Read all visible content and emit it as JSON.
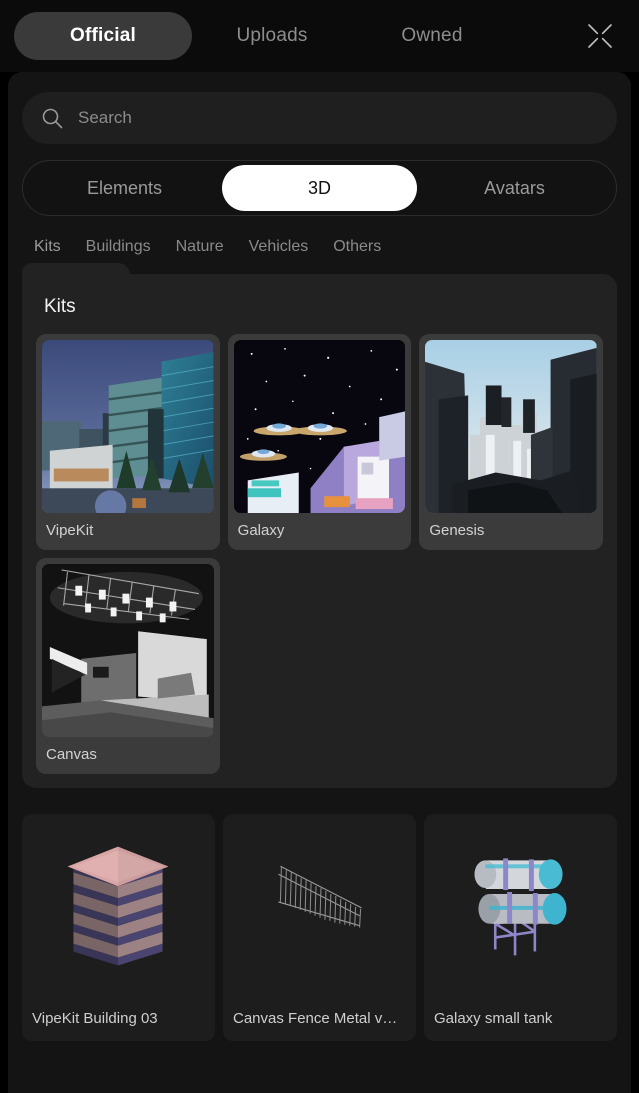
{
  "topbar": {
    "tabs": [
      {
        "label": "Official",
        "active": true
      },
      {
        "label": "Uploads",
        "active": false
      },
      {
        "label": "Owned",
        "active": false
      }
    ],
    "close_icon": "close-collapse-icon"
  },
  "search": {
    "placeholder": "Search",
    "value": "",
    "icon": "search-icon"
  },
  "segmented": {
    "options": [
      {
        "label": "Elements",
        "active": false
      },
      {
        "label": "3D",
        "active": true
      },
      {
        "label": "Avatars",
        "active": false
      }
    ]
  },
  "categories": [
    {
      "label": "Kits",
      "active": true
    },
    {
      "label": "Buildings",
      "active": false
    },
    {
      "label": "Nature",
      "active": false
    },
    {
      "label": "Vehicles",
      "active": false
    },
    {
      "label": "Others",
      "active": false
    }
  ],
  "kits_group": {
    "title": "Kits",
    "cards": [
      {
        "label": "VipeKit",
        "thumb": "city-skyscrapers-dusk"
      },
      {
        "label": "Galaxy",
        "thumb": "space-station-ufo"
      },
      {
        "label": "Genesis",
        "thumb": "white-city-canyon"
      },
      {
        "label": "Canvas",
        "thumb": "greyscale-stage-lights"
      }
    ]
  },
  "assets": [
    {
      "label": "VipeKit Building 03",
      "thumb": "layered-pink-building"
    },
    {
      "label": "Canvas Fence Metal v…",
      "thumb": "metal-fence-panel"
    },
    {
      "label": "Galaxy small tank",
      "thumb": "cyan-cylinder-tanks"
    }
  ],
  "colors": {
    "page_background": "#000000",
    "panel_background": "#141414",
    "group_background": "#222222",
    "kit_card_background": "#3b3b3b",
    "asset_card_background": "#1d1d1d",
    "active_tab_background": "#3a3a3a",
    "active_segment_background": "#ffffff",
    "muted_text": "#8a8a8a",
    "primary_text": "#f2f2f2"
  }
}
